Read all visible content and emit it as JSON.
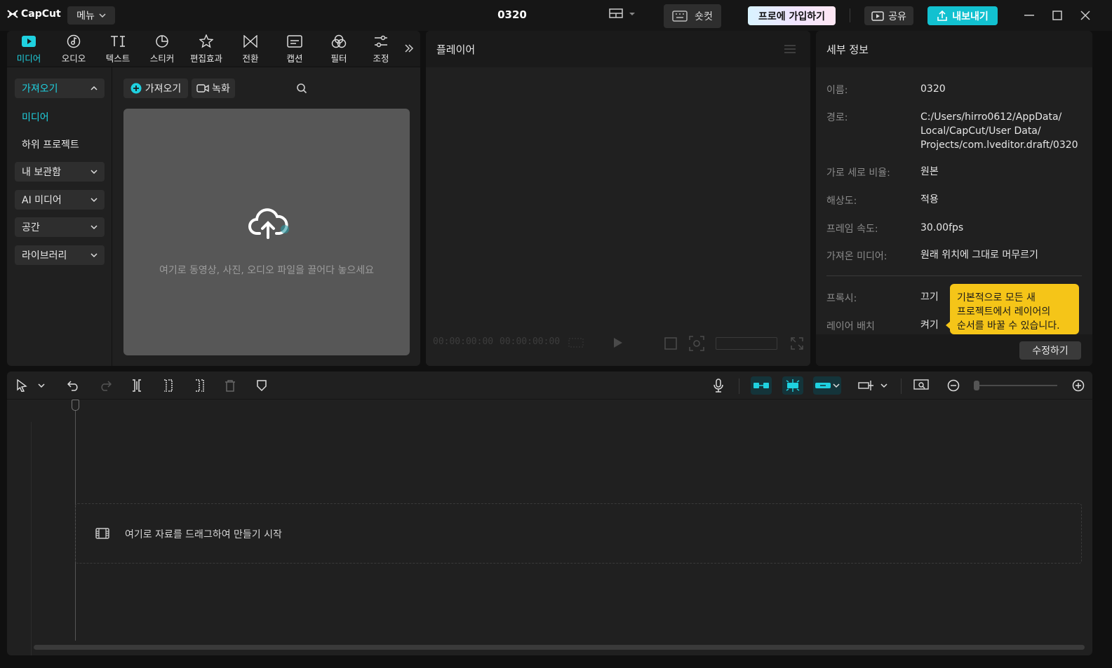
{
  "app": {
    "logo": "CapCut",
    "menu_label": "메뉴",
    "project_title": "0320",
    "shortcut_label": "숏컷",
    "pro_label": "프로에 가입하기",
    "share_label": "공유",
    "export_label": "내보내기"
  },
  "colors": {
    "accent": "#1fd1e0",
    "export_bg": "#12c1d0",
    "tooltip_bg": "#f5c518",
    "panel_bg": "#202020",
    "header_bg": "#1a1a1a"
  },
  "tabs": [
    {
      "label": "미디어",
      "icon": "media-icon",
      "active": true
    },
    {
      "label": "오디오",
      "icon": "audio-icon"
    },
    {
      "label": "텍스트",
      "icon": "text-icon"
    },
    {
      "label": "스티커",
      "icon": "sticker-icon"
    },
    {
      "label": "편집효과",
      "icon": "effects-icon"
    },
    {
      "label": "전환",
      "icon": "transition-icon"
    },
    {
      "label": "캡션",
      "icon": "caption-icon"
    },
    {
      "label": "필터",
      "icon": "filter-icon"
    },
    {
      "label": "조정",
      "icon": "adjust-icon"
    }
  ],
  "sidebar": {
    "import_group": "가져오기",
    "items": [
      "미디어",
      "하위 프로젝트"
    ],
    "groups": [
      "내 보관함",
      "AI 미디어",
      "공간",
      "라이브러리"
    ]
  },
  "media": {
    "import_button": "가져오기",
    "record_button": "녹화",
    "drop_hint": "여기로 동영상, 사진, 오디오 파일을 끌어다 놓으세요"
  },
  "player": {
    "title": "플레이어",
    "current_time": "00:00:00:00",
    "total_time": "00:00:00:00"
  },
  "details": {
    "title": "세부 정보",
    "rows": [
      {
        "label": "이름:",
        "value": "0320"
      },
      {
        "label": "경로:",
        "value_lines": [
          "C:/Users/hirro0612/AppData/",
          "Local/CapCut/User Data/",
          "Projects/com.lveditor.draft/0320"
        ]
      },
      {
        "label": "가로 세로 비율:",
        "value": "원본"
      },
      {
        "label": "해상도:",
        "value": "적용"
      },
      {
        "label": "프레임 속도:",
        "value": "30.00fps"
      },
      {
        "label": "가져온 미디어:",
        "value": "원래 위치에 그대로 머무르기"
      },
      {
        "label": "프록시:",
        "value": "끄기"
      },
      {
        "label": "레이어 배치",
        "value": "켜기"
      }
    ],
    "tooltip_lines": [
      "기본적으로 모든 새",
      "프로젝트에서 레이어의",
      "순서를 바꿀 수 있습니다."
    ],
    "edit_button": "수정하기"
  },
  "timeline": {
    "drop_hint": "여기로 자료를 드래그하여 만들기 시작"
  }
}
